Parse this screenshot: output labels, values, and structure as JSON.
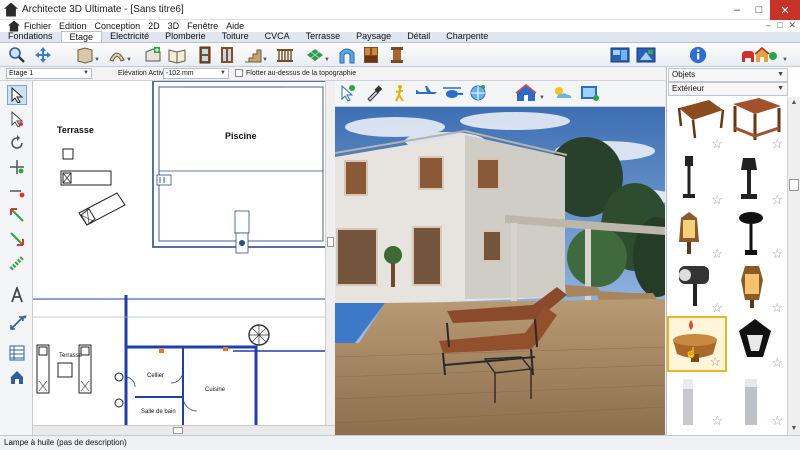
{
  "window": {
    "title": "Architecte 3D Ultimate - [Sans titre6]",
    "buttons": [
      "–",
      "□",
      "✕"
    ]
  },
  "menu": {
    "items": [
      "Fichier",
      "Edition",
      "Conception",
      "2D",
      "3D",
      "Fenêtre",
      "Aide"
    ],
    "right_controls": [
      "–",
      "□",
      "✕"
    ]
  },
  "tabs": [
    "Fondations",
    "Etage",
    "Electricité",
    "Plomberie",
    "Toiture",
    "CVCA",
    "Terrasse",
    "Paysage",
    "Détail",
    "Charpente"
  ],
  "active_tab": "Etage",
  "propbar": {
    "floor_select": "Etage 1",
    "elevation_label": "Elévation Active:",
    "elevation_value": "-102 mm",
    "float_checkbox_label": "Flotter au-dessus de la topographie"
  },
  "plan": {
    "labels": {
      "terrasse_top": "Terrasse",
      "piscine": "Piscine",
      "terrasse_bottom": "Terrasse",
      "cellier": "Cellier",
      "cuisine": "Cuisine",
      "salle_de_bain": "Salle de bain"
    }
  },
  "catalog": {
    "category_select": "Objets",
    "subcategory_select": "Extérieur",
    "items": [
      {
        "icon": "pergola-icon"
      },
      {
        "icon": "gazebo-icon"
      },
      {
        "icon": "garden-lamp-post-icon"
      },
      {
        "icon": "lantern-post-icon"
      },
      {
        "icon": "wall-lantern-icon"
      },
      {
        "icon": "black-wall-lantern-icon"
      },
      {
        "icon": "spotlight-icon"
      },
      {
        "icon": "bronze-wall-lantern-icon"
      },
      {
        "icon": "oil-lamp-icon",
        "caption": "Lampe à huile",
        "selected": true
      },
      {
        "icon": "hanging-lantern-icon"
      },
      {
        "icon": "bollard-light-icon"
      },
      {
        "icon": "column-light-icon"
      }
    ]
  },
  "status": {
    "text": "Lampe à huile (pas de description)"
  },
  "colors": {
    "accent_selection": "#f0b323",
    "close_button": "#c7322b",
    "wall_blue": "#1f3fae"
  }
}
